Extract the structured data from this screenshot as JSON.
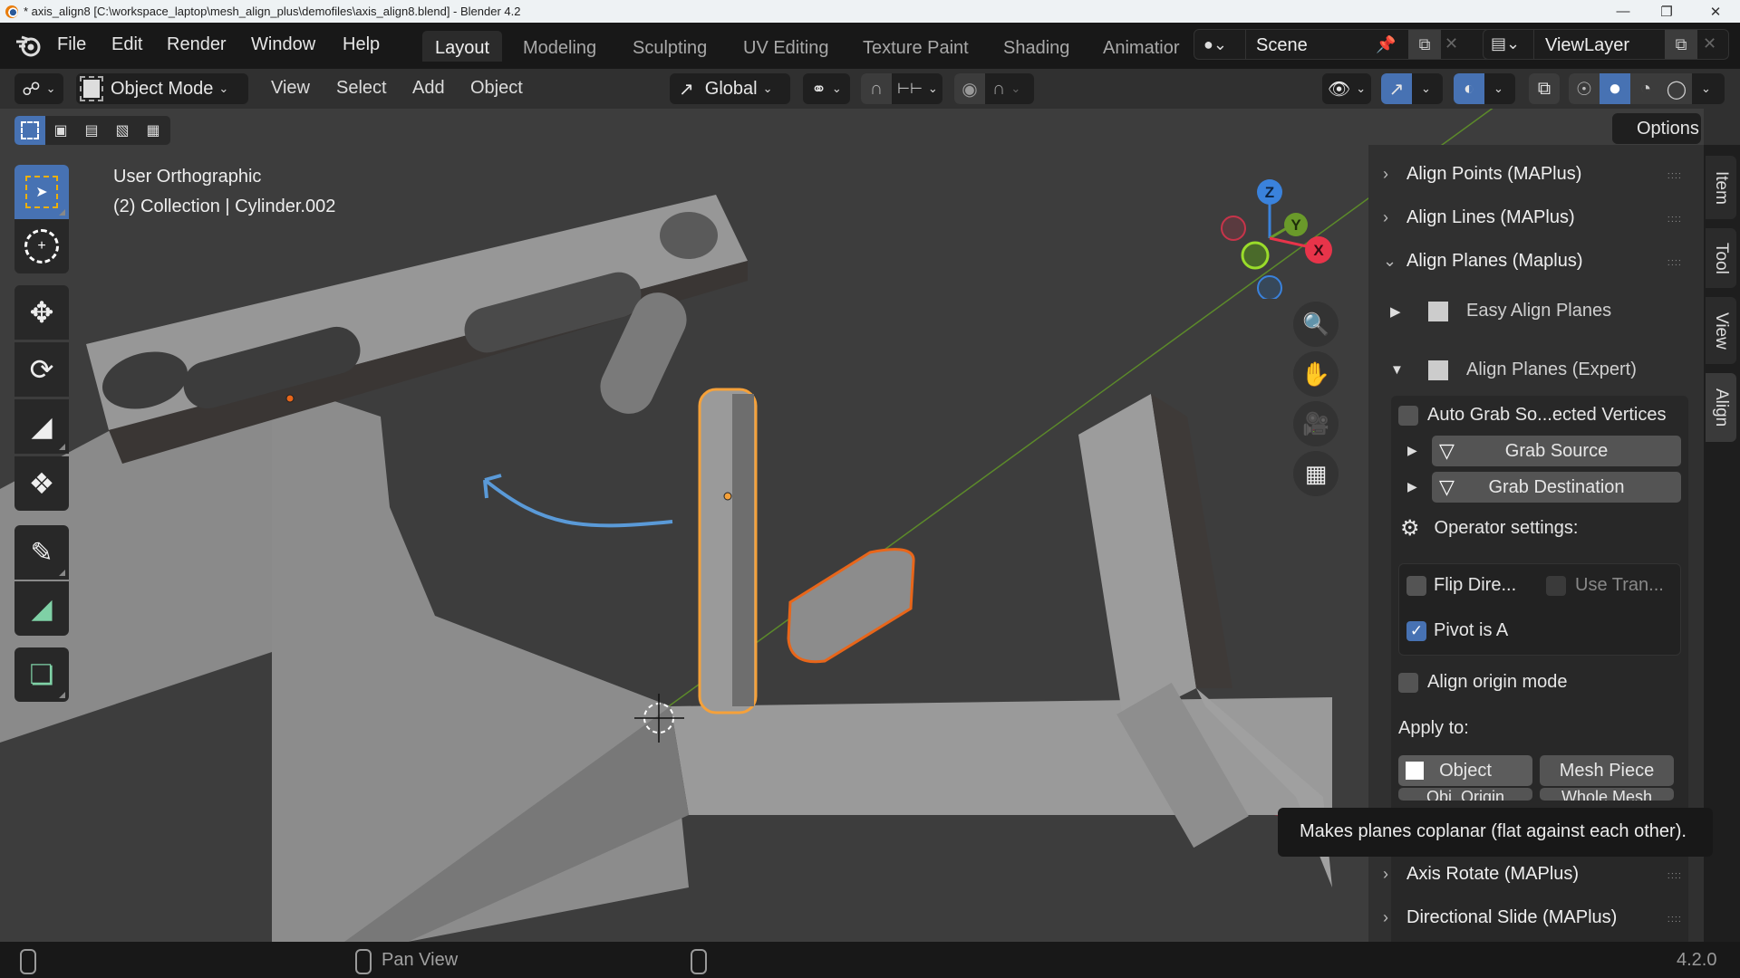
{
  "window": {
    "title": "* axis_align8 [C:\\workspace_laptop\\mesh_align_plus\\demofiles\\axis_align8.blend] - Blender 4.2",
    "controls": [
      "minimize",
      "maximize",
      "close"
    ]
  },
  "menubar": {
    "items": [
      "File",
      "Edit",
      "Render",
      "Window",
      "Help"
    ]
  },
  "workspaces": {
    "tabs": [
      "Layout",
      "Modeling",
      "Sculpting",
      "UV Editing",
      "Texture Paint",
      "Shading",
      "Animatior"
    ],
    "active": "Layout"
  },
  "scene": {
    "value": "Scene"
  },
  "view_layer": {
    "value": "ViewLayer"
  },
  "header": {
    "mode": "Object Mode",
    "menus": [
      "View",
      "Select",
      "Add",
      "Object"
    ],
    "orientation": "Global",
    "options_label": "Options"
  },
  "viewport": {
    "view_name": "User Orthographic",
    "object_info": "(2) Collection | Cylinder.002",
    "gizmo_axes": [
      "Z",
      "Y",
      "X"
    ],
    "colors": {
      "selected_active": "#f5a13a",
      "selected": "#e8661a",
      "annotation": "#5a9ad8",
      "x_axis": "#c8344a",
      "y_axis": "#6a9a2a",
      "z_axis": "#3a82dc"
    }
  },
  "toolbar": {
    "tools": [
      "select-box",
      "cursor",
      "move",
      "rotate",
      "scale",
      "transform",
      "annotate",
      "measure",
      "add-cube"
    ]
  },
  "npanel": {
    "panels": [
      {
        "label": "Align Points (MAPlus)",
        "expanded": false
      },
      {
        "label": "Align Lines (MAPlus)",
        "expanded": false
      },
      {
        "label": "Align Planes (Maplus)",
        "expanded": true
      }
    ],
    "subpanels": [
      {
        "label": "Easy Align Planes",
        "expanded": false
      },
      {
        "label": "Align Planes (Expert)",
        "expanded": true
      }
    ],
    "auto_grab": {
      "label": "Auto Grab So...ected Vertices",
      "checked": false
    },
    "grab_source": "Grab Source",
    "grab_destination": "Grab Destination",
    "operator_settings": "Operator settings:",
    "flip_direction": {
      "label": "Flip Dire...",
      "checked": false
    },
    "use_transform": {
      "label": "Use Tran...",
      "checked": false
    },
    "pivot_is_a": {
      "label": "Pivot is A",
      "checked": true
    },
    "align_origin": {
      "label": "Align origin mode",
      "checked": false
    },
    "apply_to": "Apply to:",
    "apply_object": "Object",
    "apply_mesh_piece": "Mesh Piece",
    "apply_row2_a": "Obj. Origin",
    "apply_row2_b": "Whole Mesh",
    "more_panels": [
      {
        "label": "Axis Rotate (MAPlus)",
        "expanded": false
      },
      {
        "label": "Directional Slide (MAPlus)",
        "expanded": false
      }
    ],
    "tabs": [
      "Item",
      "Tool",
      "View",
      "Align"
    ],
    "active_tab": "Align"
  },
  "tooltip": {
    "text": "Makes planes coplanar (flat against each other)."
  },
  "statusbar": {
    "middle": "Pan View",
    "version": "4.2.0"
  }
}
